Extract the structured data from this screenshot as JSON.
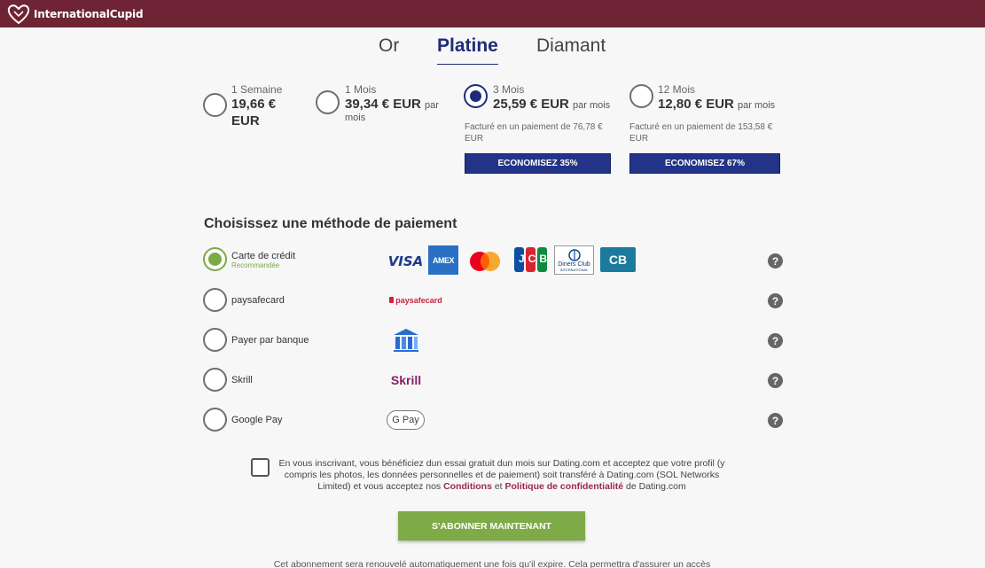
{
  "brand": {
    "name": "InternationalCupid"
  },
  "tabs": [
    {
      "label": "Or"
    },
    {
      "label": "Platine"
    },
    {
      "label": "Diamant"
    }
  ],
  "plans": [
    {
      "duration": "1 Semaine",
      "price": "19,66 €",
      "price_line2": "EUR",
      "unit": "",
      "billed": "",
      "save": ""
    },
    {
      "duration": "1 Mois",
      "price": "39,34 € EUR",
      "unit": "par",
      "unit2": "mois",
      "billed": "",
      "save": ""
    },
    {
      "duration": "3 Mois",
      "price": "25,59 € EUR",
      "unit": "par mois",
      "billed": "Facturé en un paiement de 76,78 € EUR",
      "save": "ECONOMISEZ 35%"
    },
    {
      "duration": "12 Mois",
      "price": "12,80 € EUR",
      "unit": "par mois",
      "billed": "Facturé en un paiement de 153,58 € EUR",
      "save": "ECONOMISEZ 67%"
    }
  ],
  "payment": {
    "title": "Choisissez une méthode de paiement",
    "methods": [
      {
        "label": "Carte de crédit",
        "sub": "Recommandée"
      },
      {
        "label": "paysafecard"
      },
      {
        "label": "Payer par banque"
      },
      {
        "label": "Skrill"
      },
      {
        "label": "Google Pay"
      }
    ],
    "logos": {
      "visa": "VISA",
      "amex": "AMEX",
      "jcb": "JCB",
      "diners": "Diners Club",
      "diners_sub": "INTERNATIONAL",
      "cb": "CB",
      "paysafe": "paysafecard",
      "skrill": "Skrill",
      "gpay": "G Pay"
    },
    "help": "?"
  },
  "consent": {
    "text_before": "En vous inscrivant, vous bénéficiez dun essai gratuit dun mois sur Dating.com et acceptez que votre profil (y compris les photos, les données personnelles et de paiement) soit transféré à Dating.com (SOL Networks Limited) et vous acceptez nos ",
    "link_conditions": "Conditions",
    "and": " et ",
    "link_privacy": "Politique de confidentialité",
    "text_after": " de Dating.com"
  },
  "subscribe_label": "S'ABONNER MAINTENANT",
  "footer_note": "Cet abonnement sera renouvelé automatiquement une fois qu'il expire. Cela permettra d'assurer un accès",
  "colors": {
    "topbar": "#6e2434",
    "accent": "#1f2b7a",
    "save": "#233488",
    "green": "#7eaa47"
  }
}
